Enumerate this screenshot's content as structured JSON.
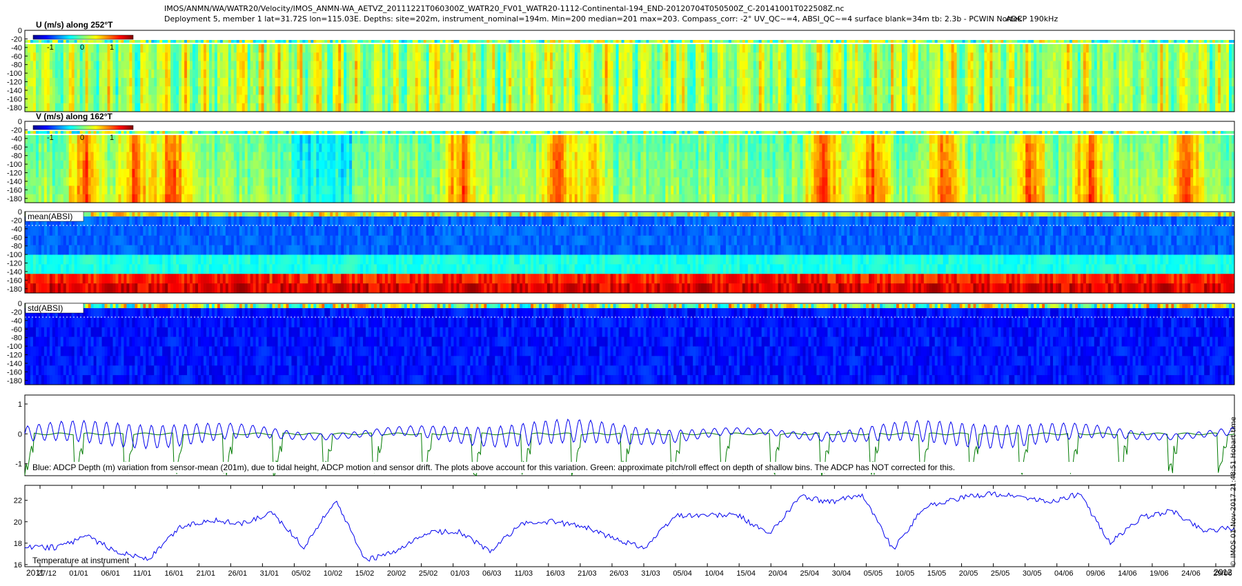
{
  "header": {
    "line1": "IMOS/ANMN/WA/WATR20/Velocity/IMOS_ANMN-WA_AETVZ_20111221T060300Z_WATR20_FV01_WATR20-1112-Continental-194_END-20120704T050500Z_C-20141001T022508Z.nc",
    "line2": "Deployment 5, member 1 lat=31.72S lon=115.03E. Depths: site=202m, instrument_nominal=194m. Min=200 median=201 max=203. Compass_corr: -2° UV_QC~=4, ABSI_QC~=4 surface blank=34m tb: 2.3b - PCWIN Nortek",
    "line3": "ADCP 190kHz"
  },
  "side_label": "© IMOS 01-Nov-2017 21:48:51 Hobart time",
  "panels": {
    "u": {
      "label": "U (m/s) along 252°T",
      "cbar_ticks": [
        "-1",
        "0",
        "1"
      ]
    },
    "v": {
      "label": "V (m/s) along 162°T",
      "cbar_ticks": [
        "-1",
        "0",
        "1"
      ]
    },
    "mean": {
      "label": "mean(ABSI)"
    },
    "std": {
      "label": "std(ABSI)"
    },
    "depth": {
      "label": "Blue: ADCP Depth (m) variation from sensor-mean (201m), due to tidal height, ADCP motion and sensor drift. The plots above account for this variation. Green: approximate pitch/roll effect on depth of shallow bins. The ADCP has NOT corrected for this."
    },
    "temp": {
      "label": "Temperature at instrument"
    }
  },
  "colors": {
    "blue_line": "#0000ee",
    "green_line": "#007a00",
    "dotted": "#ffffff"
  },
  "chart_data": [
    {
      "type": "heatmap",
      "title": "U (m/s) along 252°T",
      "yticks": [
        0,
        -20,
        -40,
        -60,
        -80,
        -100,
        -120,
        -140,
        -160,
        -180
      ],
      "color_range": [
        -1.5,
        1.5
      ],
      "colorbar_ticks": [
        -1,
        0,
        1
      ],
      "description_values": "mostly near 0 to 0.5 m/s"
    },
    {
      "type": "heatmap",
      "title": "V (m/s) along 162°T",
      "yticks": [
        0,
        -20,
        -40,
        -60,
        -80,
        -100,
        -120,
        -140,
        -160,
        -180
      ],
      "color_range": [
        -1.5,
        1.5
      ],
      "colorbar_ticks": [
        -1,
        0,
        1
      ]
    },
    {
      "type": "heatmap",
      "title": "mean(ABSI)",
      "yticks": [
        0,
        -20,
        -40,
        -60,
        -80,
        -100,
        -120,
        -140,
        -160,
        -180
      ]
    },
    {
      "type": "heatmap",
      "title": "std(ABSI)",
      "yticks": [
        0,
        -20,
        -40,
        -60,
        -80,
        -100,
        -120,
        -140,
        -160,
        -180
      ]
    },
    {
      "type": "line",
      "yticks": [
        1,
        0,
        -1
      ],
      "ylim": [
        -1.4,
        1.3
      ],
      "series": []
    },
    {
      "type": "line",
      "yticks": [
        16,
        18,
        20,
        22
      ],
      "ylim": [
        15.8,
        23.4
      ],
      "x_start_label": "2011",
      "x_end_label": "2012",
      "x_tick_labels": [
        "27/12",
        "01/01",
        "06/01",
        "11/01",
        "16/01",
        "21/01",
        "26/01",
        "31/01",
        "05/02",
        "10/02",
        "15/02",
        "20/02",
        "25/02",
        "01/03",
        "06/03",
        "11/03",
        "16/03",
        "21/03",
        "26/03",
        "31/03",
        "05/04",
        "10/04",
        "15/04",
        "20/04",
        "25/04",
        "30/04",
        "05/05",
        "10/05",
        "15/05",
        "20/05",
        "25/05",
        "30/05",
        "04/06",
        "09/06",
        "14/06",
        "19/06",
        "24/06",
        "29/06"
      ],
      "series": [
        {
          "x": [
            0,
            5,
            10,
            15,
            20,
            25,
            30,
            35,
            40,
            45,
            50,
            55,
            60,
            65,
            70,
            75,
            80,
            85,
            90,
            95,
            100,
            105,
            110,
            115,
            120,
            125,
            130,
            135,
            140,
            145,
            150,
            155,
            160,
            165,
            170,
            175,
            180,
            185,
            190,
            195
          ],
          "y": [
            17.6,
            17.6,
            18.6,
            17.2,
            16.5,
            19.5,
            20.2,
            19.8,
            20.8,
            17.6,
            22.0,
            16.4,
            17.2,
            19.0,
            19.1,
            17.2,
            19.8,
            20.0,
            19.6,
            18.4,
            17.6,
            20.6,
            20.6,
            20.6,
            18.8,
            22.4,
            21.8,
            22.6,
            17.4,
            21.4,
            22.1,
            22.6,
            22.4,
            21.8,
            22.6,
            18.0,
            20.4,
            21.0,
            19.2,
            19.4
          ]
        }
      ]
    }
  ]
}
